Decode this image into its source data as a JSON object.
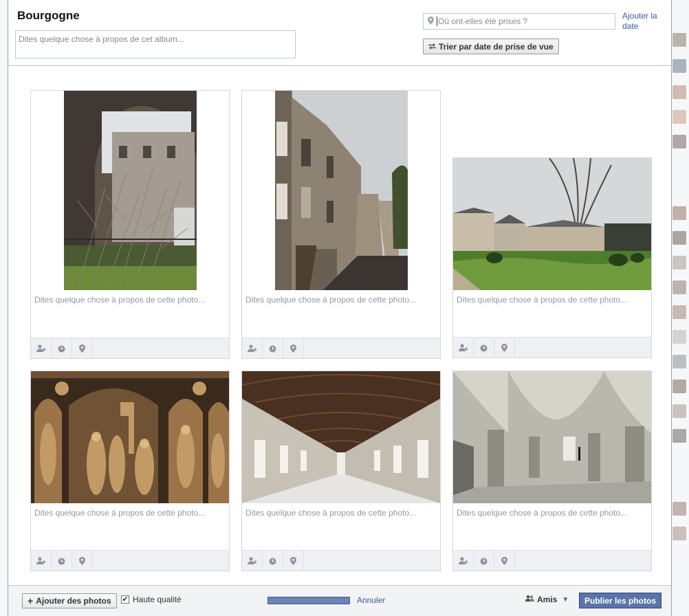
{
  "album": {
    "title": "Bourgogne",
    "description_placeholder": "Dites quelque chose à propos de cet album..."
  },
  "location": {
    "placeholder": "Où ont-elles été prises ?"
  },
  "add_date_label": "Ajouter la date",
  "sort_button_label": "Trier par date de prise de vue",
  "photos": [
    {
      "caption_placeholder": "Dites quelque chose à propos de cette photo..."
    },
    {
      "caption_placeholder": "Dites quelque chose à propos de cette photo..."
    },
    {
      "caption_placeholder": "Dites quelque chose à propos de cette photo..."
    },
    {
      "caption_placeholder": "Dites quelque chose à propos de cette photo..."
    },
    {
      "caption_placeholder": "Dites quelque chose à propos de cette photo..."
    },
    {
      "caption_placeholder": "Dites quelque chose à propos de cette photo..."
    }
  ],
  "photo_tools": [
    "tag-person-icon",
    "clock-icon",
    "location-pin-icon"
  ],
  "footer": {
    "add_photos_label": "Ajouter des photos",
    "high_quality_label": "Haute qualité",
    "high_quality_checked": true,
    "upload_progress": 1.0,
    "cancel_label": "Annuler",
    "audience_label": "Amis",
    "publish_label": "Publier les photos"
  },
  "colors": {
    "link": "#3b5998",
    "publish_button": "#5b74a8"
  }
}
